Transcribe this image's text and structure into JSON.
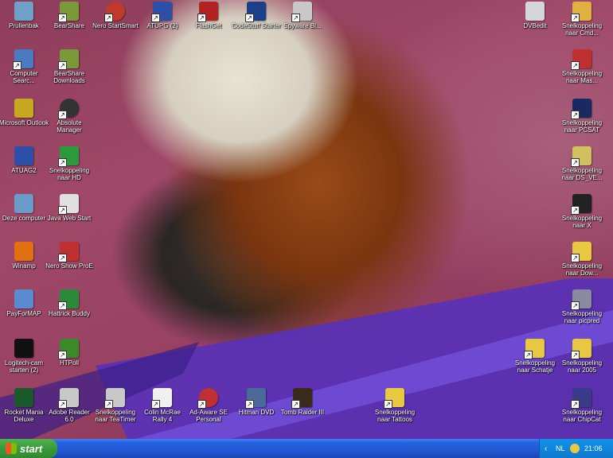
{
  "desktop": {
    "icons": [
      {
        "id": "prullenbak",
        "label": "Prullenbak",
        "color": "#6fa0c8",
        "glyph": "♻"
      },
      {
        "id": "bearshare",
        "label": "BearShare",
        "color": "#7a9a3a",
        "glyph": "🐻"
      },
      {
        "id": "nero",
        "label": "Nero StartSmart",
        "color": "#c0392b",
        "glyph": "●"
      },
      {
        "id": "atupgrade",
        "label": "ATUPG (2)",
        "color": "#2d4fa8",
        "glyph": "i"
      },
      {
        "id": "flashget",
        "label": "FlashGet",
        "color": "#b22222",
        "glyph": "¥"
      },
      {
        "id": "codestuff",
        "label": "CodeStuff Starter",
        "color": "#1b3f8a",
        "glyph": "⚡"
      },
      {
        "id": "spyware",
        "label": "Spyware Bl...",
        "color": "#c8c8c8",
        "glyph": "☺"
      },
      {
        "id": "dvbedit",
        "label": "DVBedit",
        "color": "#d6d6d6",
        "glyph": "✎"
      },
      {
        "id": "snel-cmd",
        "label": "Snelkoppeling naar Cmd...",
        "color": "#e0b040",
        "glyph": "⚑"
      },
      {
        "id": "computer-search",
        "label": "Computer Searc...",
        "color": "#4a7ac0",
        "glyph": "▤"
      },
      {
        "id": "bearshare-dl",
        "label": "BearShare Downloads",
        "color": "#7a9a3a",
        "glyph": "▣"
      },
      {
        "id": "snel-mas",
        "label": "Snelkoppeling naar Mas...",
        "color": "#c03030",
        "glyph": "✦"
      },
      {
        "id": "outlook",
        "label": "Microsoft Outlook",
        "color": "#c8a820",
        "glyph": "✉"
      },
      {
        "id": "absolute",
        "label": "Absolute Manager",
        "color": "#333333",
        "glyph": "⚡"
      },
      {
        "id": "snel-pcsat",
        "label": "Snelkoppeling naar PCSAT",
        "color": "#1a2a60",
        "glyph": "◉"
      },
      {
        "id": "atuag2",
        "label": "ATUAG2",
        "color": "#2d4fa8",
        "glyph": "i"
      },
      {
        "id": "snel-hd",
        "label": "Snelkoppeling naar HD",
        "color": "#2a9a3a",
        "glyph": "H"
      },
      {
        "id": "snel-ds",
        "label": "Snelkoppeling naar DS_VE...",
        "color": "#d0c060",
        "glyph": "🔍"
      },
      {
        "id": "deze-computer",
        "label": "Deze computer",
        "color": "#6a9ac8",
        "glyph": "▭"
      },
      {
        "id": "java",
        "label": "Java Web Start",
        "color": "#e0e0e0",
        "glyph": "☕"
      },
      {
        "id": "snel-x",
        "label": "Snelkoppeling naar X",
        "color": "#222222",
        "glyph": "X"
      },
      {
        "id": "winamp",
        "label": "Winamp",
        "color": "#e07010",
        "glyph": "⚡"
      },
      {
        "id": "nero-showtime",
        "label": "Nero Show ProE",
        "color": "#c03030",
        "glyph": "✿"
      },
      {
        "id": "snel-dow",
        "label": "Snelkoppeling naar Dow...",
        "color": "#e8c840",
        "glyph": "▭"
      },
      {
        "id": "paypal",
        "label": "PayForMAP",
        "color": "#5a8ad0",
        "glyph": "▦"
      },
      {
        "id": "hattrick",
        "label": "Hattrick Buddy",
        "color": "#2a8a3a",
        "glyph": "HB"
      },
      {
        "id": "snel-picpred",
        "label": "Snelkoppeling naar picpred",
        "color": "#8a8aa0",
        "glyph": "✎"
      },
      {
        "id": "logitech",
        "label": "Logitech-cam starten (2)",
        "color": "#111111",
        "glyph": "W"
      },
      {
        "id": "htpoll",
        "label": "HTPoll",
        "color": "#3a8a2a",
        "glyph": "☺"
      },
      {
        "id": "snel-schatje",
        "label": "Snelkoppeling naar Schatje",
        "color": "#e8c840",
        "glyph": "▭"
      },
      {
        "id": "snel-2005",
        "label": "Snelkoppeling naar 2005",
        "color": "#e8c840",
        "glyph": "▭"
      },
      {
        "id": "rocket",
        "label": "Rocket Mania Deluxe",
        "color": "#1a5a2a",
        "glyph": "✶"
      },
      {
        "id": "adobe",
        "label": "Adobe Reader 6.0",
        "color": "#c8c8c8",
        "glyph": "A"
      },
      {
        "id": "snel-tealtimer",
        "label": "Snelkoppeling naar TeaTimer",
        "color": "#c8c8c8",
        "glyph": "▦"
      },
      {
        "id": "colin",
        "label": "Colin McRae Rally 4",
        "color": "#f0f0f0",
        "glyph": "04"
      },
      {
        "id": "ad-aware",
        "label": "Ad-Aware SE Personal",
        "color": "#c03030",
        "glyph": "✪"
      },
      {
        "id": "hitman",
        "label": "Hitman DVD",
        "color": "#4a6a9a",
        "glyph": "✈"
      },
      {
        "id": "tomb-raider",
        "label": "Tomb Raider III",
        "color": "#3a2a1a",
        "glyph": "☻"
      },
      {
        "id": "snel-tattoos",
        "label": "Snelkoppeling naar Tattoos",
        "color": "#e8c840",
        "glyph": "▭"
      },
      {
        "id": "snel-chipcat",
        "label": "Snelkoppeling naar ChipCat",
        "color": "#3a3a8a",
        "glyph": "✎"
      }
    ]
  },
  "taskbar": {
    "start_label": "start",
    "tray": {
      "lang": "NL",
      "time": "21:06"
    }
  }
}
